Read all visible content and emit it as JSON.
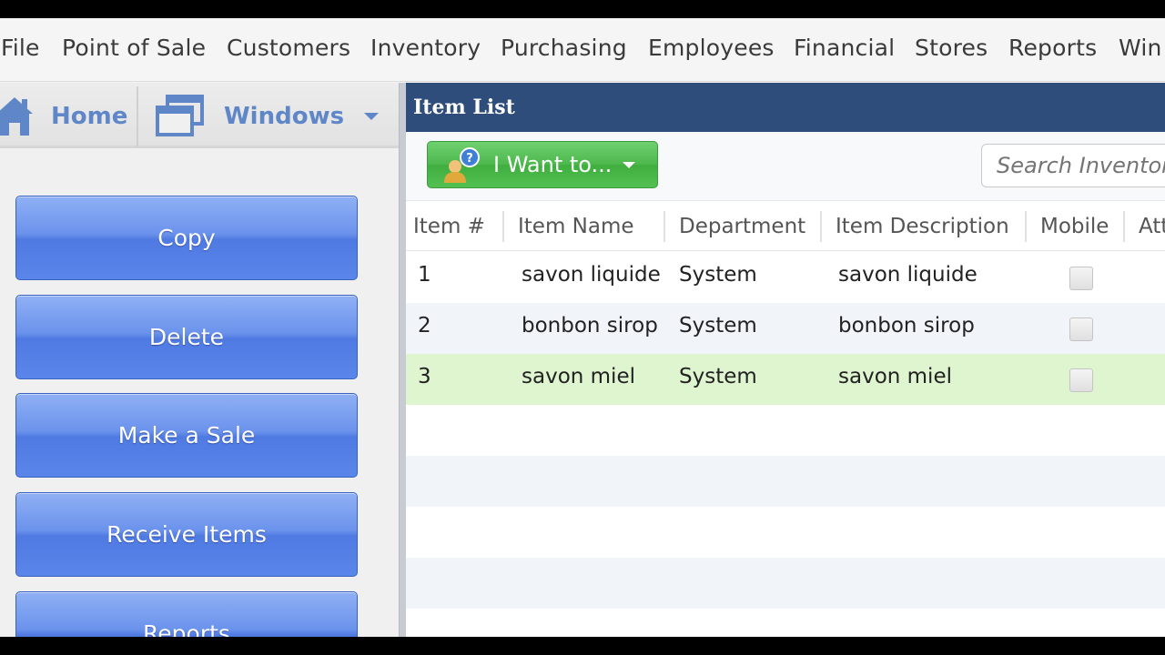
{
  "menu": [
    "File",
    "Point of Sale",
    "Customers",
    "Inventory",
    "Purchasing",
    "Employees",
    "Financial",
    "Stores",
    "Reports",
    "Win"
  ],
  "nav": {
    "home_label": "Home",
    "windows_label": "Windows"
  },
  "sidebar_buttons": [
    "Copy",
    "Delete",
    "Make a Sale",
    "Receive Items",
    "Reports"
  ],
  "panel": {
    "title": "Item List",
    "i_want_label": "I Want to...",
    "search_placeholder": "Search Inventory"
  },
  "table": {
    "columns": [
      "Item #",
      "Item Name",
      "Department",
      "Item Description",
      "Mobile",
      "Att"
    ],
    "rows": [
      {
        "num": "1",
        "name": "savon liquide",
        "department": "System",
        "description": "savon liquide",
        "mobile": false
      },
      {
        "num": "2",
        "name": "bonbon sirop",
        "department": "System",
        "description": "bonbon sirop",
        "mobile": false
      },
      {
        "num": "3",
        "name": "savon miel",
        "department": "System",
        "description": "savon miel",
        "mobile": false
      }
    ],
    "selected_row": 2
  },
  "colors": {
    "nav_text": "#5f87c8",
    "title_bar": "#2e4d7b",
    "side_button": "#5a86ea",
    "action_button": "#4cb84c",
    "selected_row": "#dff5cf"
  },
  "icons": {
    "home": "home-icon",
    "windows": "windows-icon",
    "i_want": "user-help-icon"
  }
}
